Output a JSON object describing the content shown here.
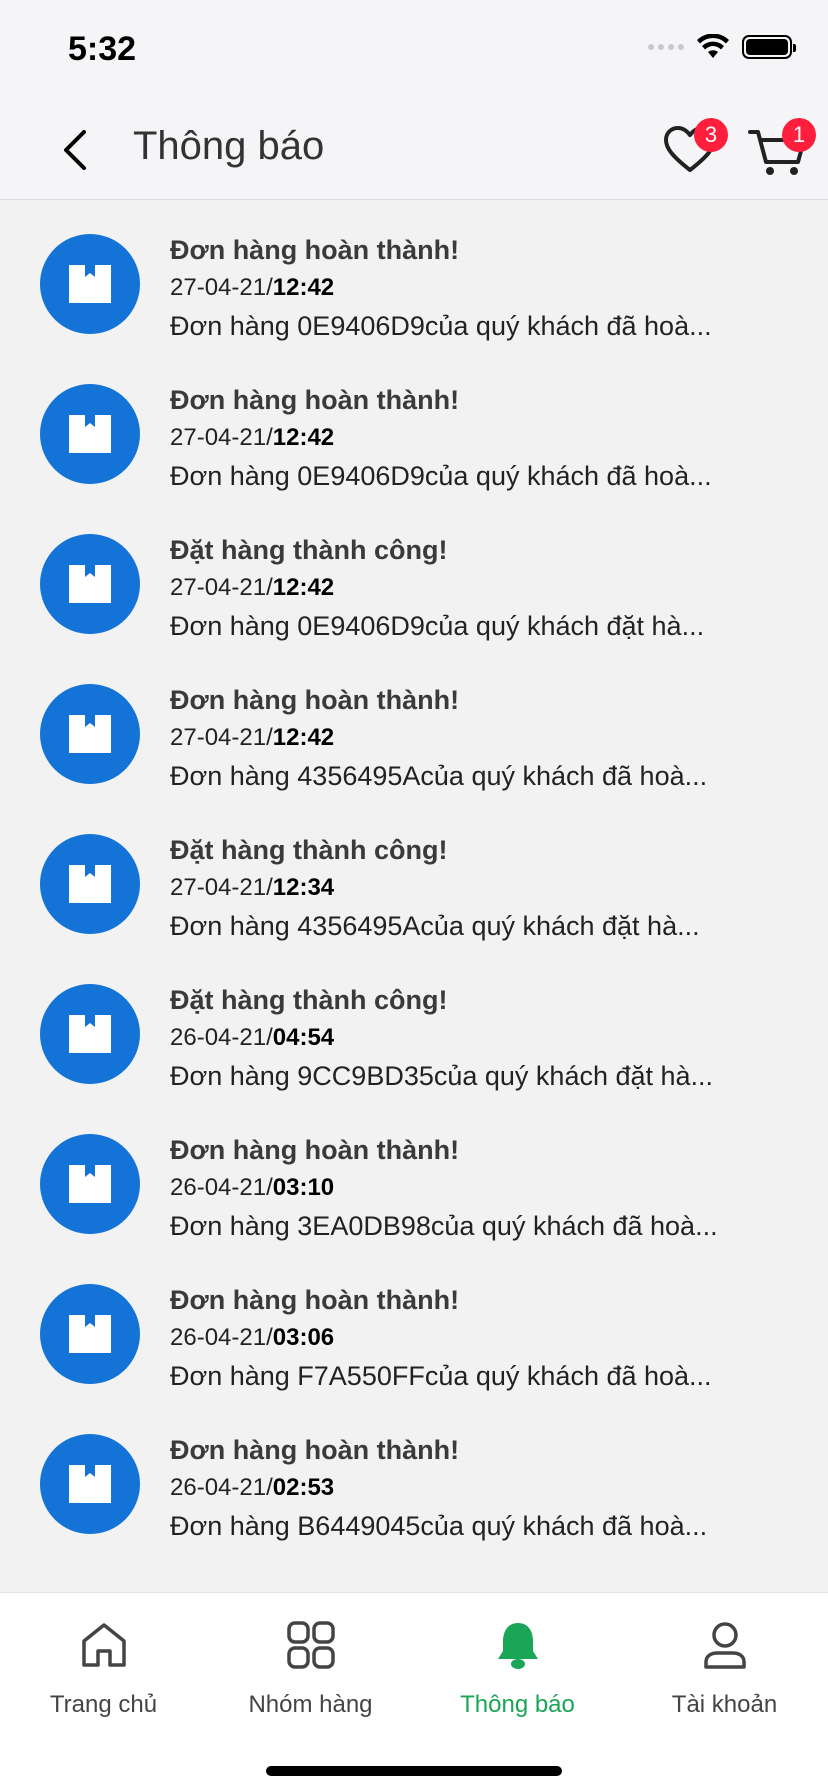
{
  "status_bar": {
    "time": "5:32"
  },
  "header": {
    "title": "Thông báo",
    "wishlist_count": "3",
    "cart_count": "1"
  },
  "notifications": [
    {
      "title": "Đơn hàng hoàn thành!",
      "date": "27-04-21/",
      "time": "12:42",
      "body": "Đơn hàng 0E9406D9của quý khách đã hoà..."
    },
    {
      "title": "Đơn hàng hoàn thành!",
      "date": "27-04-21/",
      "time": "12:42",
      "body": "Đơn hàng 0E9406D9của quý khách đã hoà..."
    },
    {
      "title": "Đặt hàng thành công!",
      "date": "27-04-21/",
      "time": "12:42",
      "body": "Đơn hàng 0E9406D9của quý khách đặt hà..."
    },
    {
      "title": "Đơn hàng hoàn thành!",
      "date": "27-04-21/",
      "time": "12:42",
      "body": "Đơn hàng 4356495Acủa quý khách đã hoà..."
    },
    {
      "title": "Đặt hàng thành công!",
      "date": "27-04-21/",
      "time": "12:34",
      "body": "Đơn hàng 4356495Acủa quý khách đặt hà..."
    },
    {
      "title": "Đặt hàng thành công!",
      "date": "26-04-21/",
      "time": "04:54",
      "body": "Đơn hàng 9CC9BD35của quý khách đặt hà..."
    },
    {
      "title": "Đơn hàng hoàn thành!",
      "date": "26-04-21/",
      "time": "03:10",
      "body": "Đơn hàng 3EA0DB98của quý khách đã hoà..."
    },
    {
      "title": "Đơn hàng hoàn thành!",
      "date": "26-04-21/",
      "time": "03:06",
      "body": "Đơn hàng F7A550FFcủa quý khách đã hoà..."
    },
    {
      "title": "Đơn hàng hoàn thành!",
      "date": "26-04-21/",
      "time": "02:53",
      "body": "Đơn hàng B6449045của quý khách đã hoà..."
    }
  ],
  "tabbar": {
    "tabs": [
      {
        "label": "Trang chủ",
        "icon": "home-icon"
      },
      {
        "label": "Nhóm hàng",
        "icon": "grid-icon"
      },
      {
        "label": "Thông báo",
        "icon": "bell-icon",
        "active": true
      },
      {
        "label": "Tài khoản",
        "icon": "user-icon"
      }
    ]
  },
  "colors": {
    "accent": "#1aa557",
    "avatar": "#1373d6",
    "badge": "#ff1f3d",
    "background": "#f2f2f2"
  }
}
